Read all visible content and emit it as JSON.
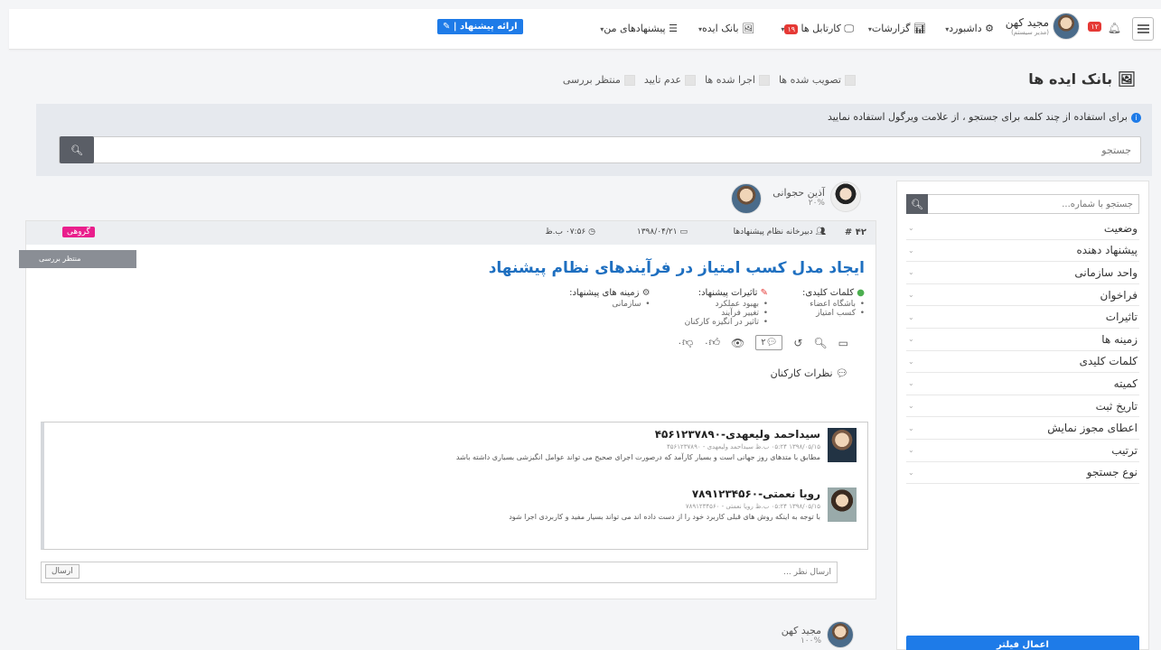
{
  "navbar": {
    "user_name": "مجید کهن",
    "user_role": "(مدیر سیستم)",
    "notif_badge": "۱۲",
    "dashboard": "داشبورد",
    "reports": "گزارشات",
    "cartable": "کارتابل ها",
    "cartable_badge": "۱۹",
    "idea_bank": "بانک ایده",
    "my_ideas": "پیشنهادهای من",
    "propose_btn": "ارائه پیشنهاد"
  },
  "page": {
    "title": "بانک ایده ها",
    "status_filters": [
      "تصویب شده ها",
      "اجرا شده ها",
      "عدم تایید",
      "منتظر بررسی"
    ]
  },
  "search": {
    "hint": "برای استفاده از چند کلمه برای جستجو ، از علامت ویرگول استفاده نمایید",
    "placeholder": "جستجو"
  },
  "sidebar": {
    "search_placeholder": "جستجو با شماره...",
    "filters": [
      "وضعیت",
      "پیشنهاد دهنده",
      "واحد سازمانی",
      "فراخوان",
      "تاثیرات",
      "زمینه ها",
      "کلمات کلیدی",
      "کمیته",
      "تاریخ ثبت",
      "اعطای مجوز نمایش",
      "ترتیب",
      "نوع جستجو"
    ],
    "apply_label": "اعمال فیلتر"
  },
  "idea": {
    "proposer1_name": "آذین حجوانی",
    "proposer1_pct": "۲۰%",
    "number": "۴۲ #",
    "secretariat": "دبیرخانه نظام پیشنهادها",
    "date": "۱۳۹۸/۰۴/۲۱",
    "time": "۰۷:۵۶ ب.ظ",
    "group_tag": "گروهی",
    "status": "منتظر بررسی",
    "title": "ایجاد مدل کسب امتیاز در فرآیندهای نظام پیشنهاد",
    "keywords_title": "کلمات کلیدی:",
    "keywords": [
      "باشگاه اعضاء",
      "کسب امتیاز"
    ],
    "impacts_title": "تاثیرات پیشنهاد:",
    "impacts": [
      "بهبود عملکرد",
      "تغییر فرآیند",
      "تاثیر در انگیزه کارکنان"
    ],
    "fields_title": "زمینه های پیشنهاد:",
    "fields": [
      "سازمانی"
    ],
    "comment_count": "۲",
    "like_count": "۰",
    "dislike_count": "۰",
    "comments_label": "نظرات کارکنان",
    "comments": [
      {
        "name": "سیداحمد ولیعهدی-۴۵۶۱۲۳۷۸۹۰",
        "meta": "۱۳۹۸/۰۵/۱۵ ۰۵:۲۴ ب.ظ سیداحمد ولیعهدی - ۴۵۶۱۲۳۷۸۹۰",
        "text": "مطابق با متدهای روز جهانی است و بسیار کارآمد که درصورت اجرای صحیح می تواند عوامل انگیزشی بسیاری داشته باشد"
      },
      {
        "name": "رویا نعمتی-۷۸۹۱۲۳۴۵۶۰",
        "meta": "۱۳۹۸/۰۵/۱۵ ۰۵:۲۴ ب.ظ رویا نعمتی - ۷۸۹۱۲۳۴۵۶۰",
        "text": "با توجه به اینکه روش های قبلی کاربرد خود را از دست داده اند می تواند بسیار مفید و کاربردی اجرا شود"
      }
    ],
    "reply_placeholder": "ارسال نظر ...",
    "send_label": "ارسال"
  },
  "next_idea": {
    "proposer_name": "مجید کهن",
    "proposer_pct": "۱۰۰%"
  }
}
